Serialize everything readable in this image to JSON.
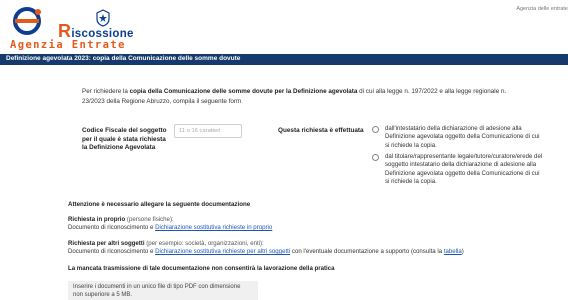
{
  "header": {
    "brand_r": "R",
    "brand_rest": "iscossione",
    "brand_sub": "Agenzia Entrate",
    "top_right": "Agenzia delle entrate"
  },
  "titlebar": {
    "title": "Definizione agevolata 2023: copia della Comunicazione delle somme dovute"
  },
  "intro": {
    "part1": "Per richiedere la ",
    "bold": "copia della Comunicazione delle somme dovute per la Definizione agevolata",
    "part2": " di cui alla legge n. 197/2022 e alla legge regionale n. 23/2023 della Regione Abruzzo, compila il seguente form"
  },
  "form": {
    "cf_label": "Codice Fiscale del soggetto per il quale è stata richiesta la Definizione Agevolata",
    "cf_placeholder": "11 o 16 caratteri",
    "request_label": "Questa richiesta è effettuata",
    "options": [
      "dall'intestatario della dichiarazione di adesione alla Definizione agevolata oggetto della Comunicazione di cui si richiede la copia.",
      "dal titolare/rappresentante legale/tutore/curatore/erede del soggetto intestatario della dichiarazione di adesione alla Definizione agevolata oggetto della Comunicazione di cui si richiede la copia."
    ]
  },
  "attachments": {
    "title": "Attenzione è necessario allegare la seguente documentazione",
    "section1": {
      "head_bold": "Richiesta in proprio",
      "head_note": " (persone fisiche):",
      "body": "Documento di riconoscimento e ",
      "link": "Dichiarazione sostitutiva richieste in proprio"
    },
    "section2": {
      "head_bold": "Richiesta per altri soggetti",
      "head_note": " (per esempio: società, organizzazioni, enti):",
      "body": "Documento di riconoscimento e ",
      "link": "Dichiarazione sostitutiva richieste per altri soggetti",
      "body2": " con l'eventuale documentazione a supporto (consulta la ",
      "link2": "tabella",
      "body3": ")"
    },
    "warning": "La mancata trasmissione di tale documentazione non consentirà la lavorazione della pratica",
    "upload_note": "Inserire i documenti in un unico file di tipo PDF con dimensione non superiore a 5 MB."
  }
}
